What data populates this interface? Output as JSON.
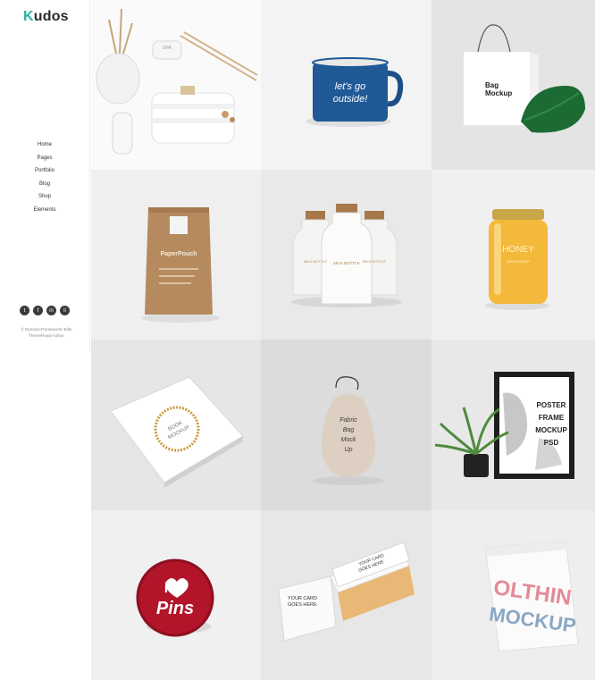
{
  "brand": {
    "first": "K",
    "rest": "udos"
  },
  "nav": [
    "Home",
    "Pages",
    "Portfolio",
    "Blog",
    "Shop",
    "Elements"
  ],
  "social": [
    "t",
    "f",
    "in",
    "li"
  ],
  "footer": {
    "line1": "© DynamicFrameworks Elite",
    "line2": "ThemeRoyal Author"
  },
  "products": {
    "spa": "SPA",
    "mug": [
      "let's go",
      "outside!"
    ],
    "bag": [
      "Bag",
      "Mockup"
    ],
    "pouch": "PaperPouch",
    "milk": [
      "MILK BOTTLE",
      "MILK BOTTLE",
      "MILK BOTTLE"
    ],
    "honey": [
      "HONEY",
      "JAR MOCKUP"
    ],
    "book": [
      "BOOK",
      "MOCKUP"
    ],
    "sack": [
      "Fabric",
      "Bag",
      "Mock",
      "Up"
    ],
    "poster": [
      "POSTER",
      "FRAME",
      "MOCKUP",
      "PSD"
    ],
    "pins": [
      "i",
      "Pins"
    ],
    "cards": [
      "YOUR CARD",
      "GOES HERE"
    ],
    "tshirt": [
      "OLTHIN",
      "MOCKUP"
    ]
  }
}
